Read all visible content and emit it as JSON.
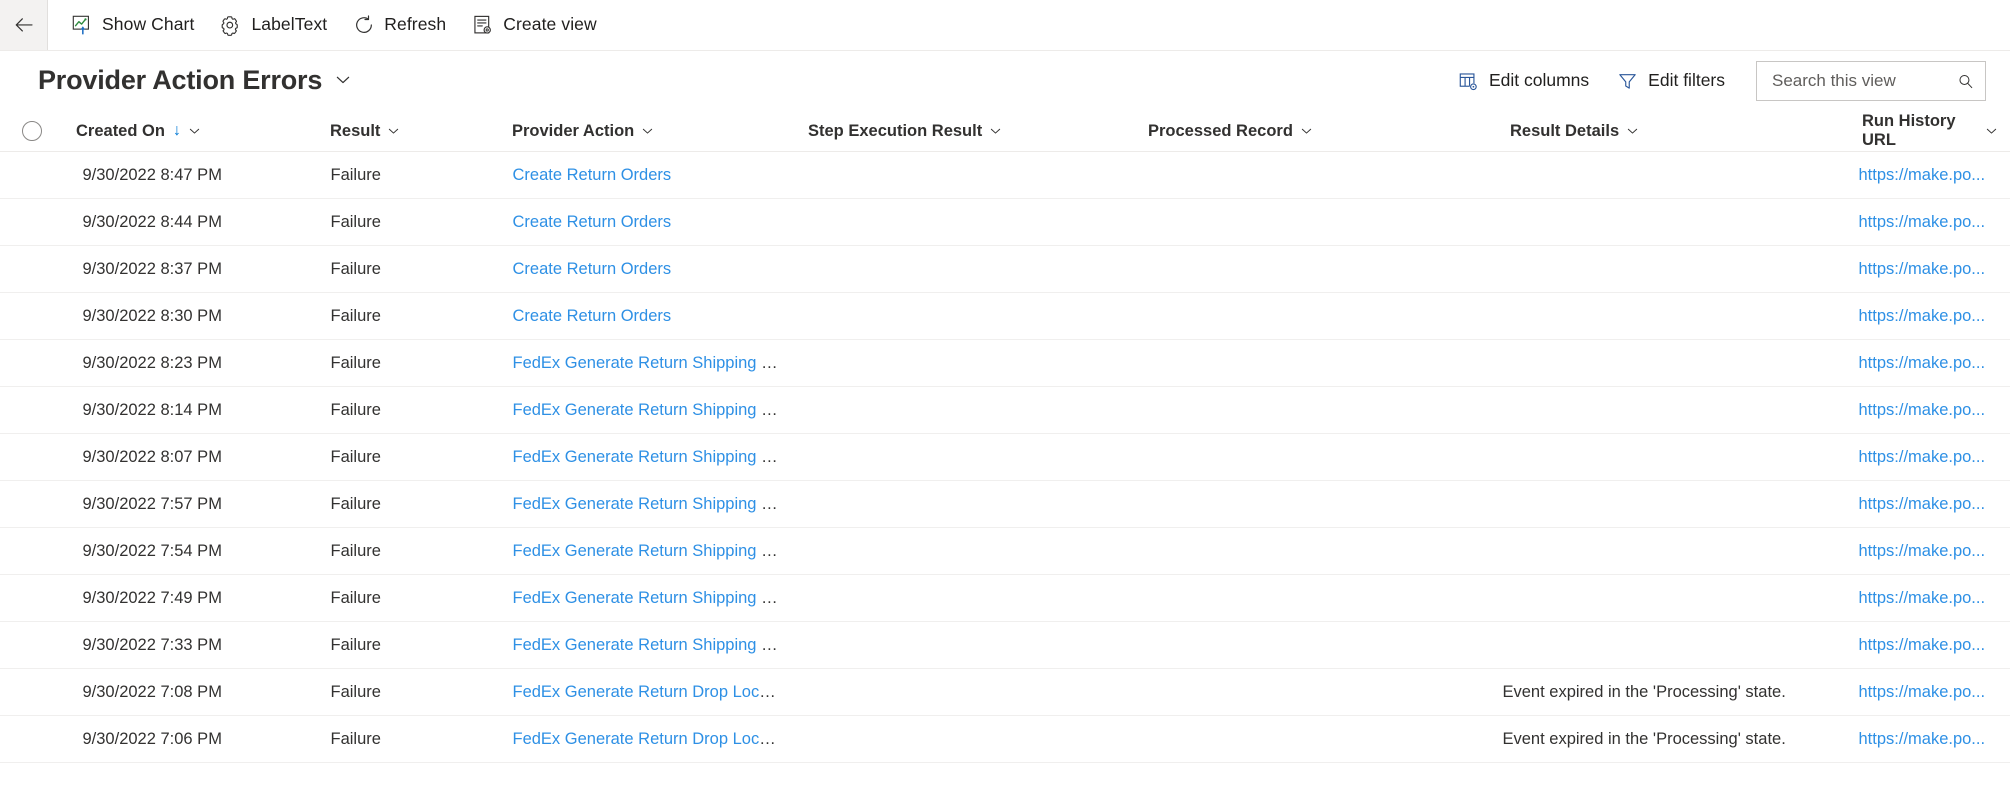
{
  "commandbar": {
    "back_label": "Back",
    "items": [
      {
        "label": "Show Chart",
        "icon": "show-chart-icon"
      },
      {
        "label": "LabelText",
        "icon": "label-text-icon"
      },
      {
        "label": "Refresh",
        "icon": "refresh-icon"
      },
      {
        "label": "Create view",
        "icon": "create-view-icon"
      }
    ]
  },
  "header": {
    "title": "Provider Action Errors",
    "title_chevron": "chevron-down-icon",
    "edit_columns_label": "Edit columns",
    "edit_filters_label": "Edit filters",
    "search": {
      "placeholder": "Search this view",
      "value": "",
      "icon": "search-icon"
    }
  },
  "grid": {
    "select_all": "select-all-circle",
    "columns": [
      {
        "key": "created_on",
        "label": "Created On",
        "sorted": true,
        "sort_dir": "down"
      },
      {
        "key": "result",
        "label": "Result",
        "sorted": false
      },
      {
        "key": "provider_action",
        "label": "Provider Action",
        "sorted": false
      },
      {
        "key": "step_execution_result",
        "label": "Step Execution Result",
        "sorted": false
      },
      {
        "key": "processed_record",
        "label": "Processed Record",
        "sorted": false
      },
      {
        "key": "result_details",
        "label": "Result Details",
        "sorted": false
      },
      {
        "key": "run_history_url",
        "label": "Run History URL",
        "sorted": false
      }
    ],
    "rows": [
      {
        "created_on": "9/30/2022 8:47 PM",
        "result": "Failure",
        "provider_action": "Create Return Orders",
        "step_execution_result": "",
        "processed_record": "",
        "result_details": "",
        "run_history_url": "https://make.po..."
      },
      {
        "created_on": "9/30/2022 8:44 PM",
        "result": "Failure",
        "provider_action": "Create Return Orders",
        "step_execution_result": "",
        "processed_record": "",
        "result_details": "",
        "run_history_url": "https://make.po..."
      },
      {
        "created_on": "9/30/2022 8:37 PM",
        "result": "Failure",
        "provider_action": "Create Return Orders",
        "step_execution_result": "",
        "processed_record": "",
        "result_details": "",
        "run_history_url": "https://make.po..."
      },
      {
        "created_on": "9/30/2022 8:30 PM",
        "result": "Failure",
        "provider_action": "Create Return Orders",
        "step_execution_result": "",
        "processed_record": "",
        "result_details": "",
        "run_history_url": "https://make.po..."
      },
      {
        "created_on": "9/30/2022 8:23 PM",
        "result": "Failure",
        "provider_action": "FedEx Generate Return Shipping La...",
        "step_execution_result": "",
        "processed_record": "",
        "result_details": "",
        "run_history_url": "https://make.po..."
      },
      {
        "created_on": "9/30/2022 8:14 PM",
        "result": "Failure",
        "provider_action": "FedEx Generate Return Shipping La...",
        "step_execution_result": "",
        "processed_record": "",
        "result_details": "",
        "run_history_url": "https://make.po..."
      },
      {
        "created_on": "9/30/2022 8:07 PM",
        "result": "Failure",
        "provider_action": "FedEx Generate Return Shipping La...",
        "step_execution_result": "",
        "processed_record": "",
        "result_details": "",
        "run_history_url": "https://make.po..."
      },
      {
        "created_on": "9/30/2022 7:57 PM",
        "result": "Failure",
        "provider_action": "FedEx Generate Return Shipping La...",
        "step_execution_result": "",
        "processed_record": "",
        "result_details": "",
        "run_history_url": "https://make.po..."
      },
      {
        "created_on": "9/30/2022 7:54 PM",
        "result": "Failure",
        "provider_action": "FedEx Generate Return Shipping La...",
        "step_execution_result": "",
        "processed_record": "",
        "result_details": "",
        "run_history_url": "https://make.po..."
      },
      {
        "created_on": "9/30/2022 7:49 PM",
        "result": "Failure",
        "provider_action": "FedEx Generate Return Shipping La...",
        "step_execution_result": "",
        "processed_record": "",
        "result_details": "",
        "run_history_url": "https://make.po..."
      },
      {
        "created_on": "9/30/2022 7:33 PM",
        "result": "Failure",
        "provider_action": "FedEx Generate Return Shipping La...",
        "step_execution_result": "",
        "processed_record": "",
        "result_details": "",
        "run_history_url": "https://make.po..."
      },
      {
        "created_on": "9/30/2022 7:08 PM",
        "result": "Failure",
        "provider_action": "FedEx Generate Return Drop Locati...",
        "step_execution_result": "",
        "processed_record": "",
        "result_details": "Event expired in the 'Processing' state.",
        "run_history_url": "https://make.po..."
      },
      {
        "created_on": "9/30/2022 7:06 PM",
        "result": "Failure",
        "provider_action": "FedEx Generate Return Drop Locati...",
        "step_execution_result": "",
        "processed_record": "",
        "result_details": "Event expired in the 'Processing' state.",
        "run_history_url": "https://make.po..."
      }
    ]
  },
  "colors": {
    "link": "#2e90e5",
    "accent": "#0078d4",
    "text": "#323130",
    "border": "#edebe9",
    "row_divider": "#f0efee"
  }
}
